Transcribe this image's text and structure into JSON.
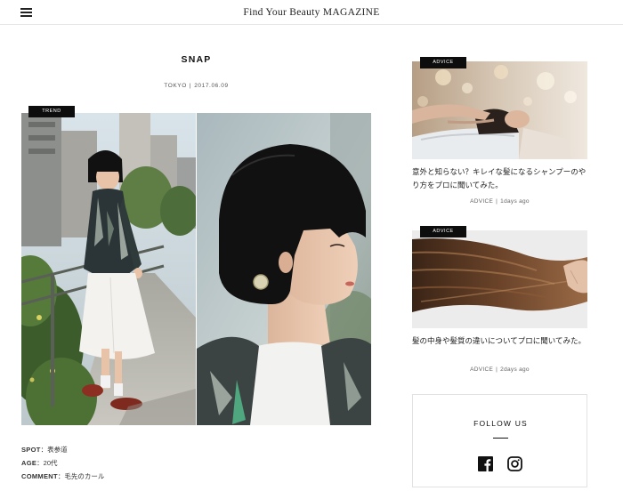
{
  "header": {
    "site_title": "Find Your Beauty MAGAZINE",
    "menu_icon": "hamburger-menu-icon"
  },
  "article": {
    "title": "SNAP",
    "location": "TOKYO",
    "separator": "|",
    "date": "2017.06.09",
    "tag": "TREND",
    "spot_label": "SPOT",
    "spot_value": "：表参道",
    "age_label": "AGE",
    "age_value": "：20代",
    "comment_label": "COMMENT",
    "comment_value": "：毛先のカール"
  },
  "sidebar": {
    "articles": [
      {
        "tag": "ADVICE",
        "title": "意外と知らない？キレイな髪になるシャンプーのやり方をプロに聞いてみた。",
        "category": "ADVICE",
        "separator": "|",
        "time": "1days ago"
      },
      {
        "tag": "ADVICE",
        "title": "髪の中身や髪質の違いについてプロに聞いてみた。",
        "category": "ADVICE",
        "separator": "|",
        "time": "2days ago"
      }
    ],
    "follow": {
      "title": "FOLLOW US",
      "icons": [
        "facebook-icon",
        "instagram-icon"
      ]
    }
  }
}
